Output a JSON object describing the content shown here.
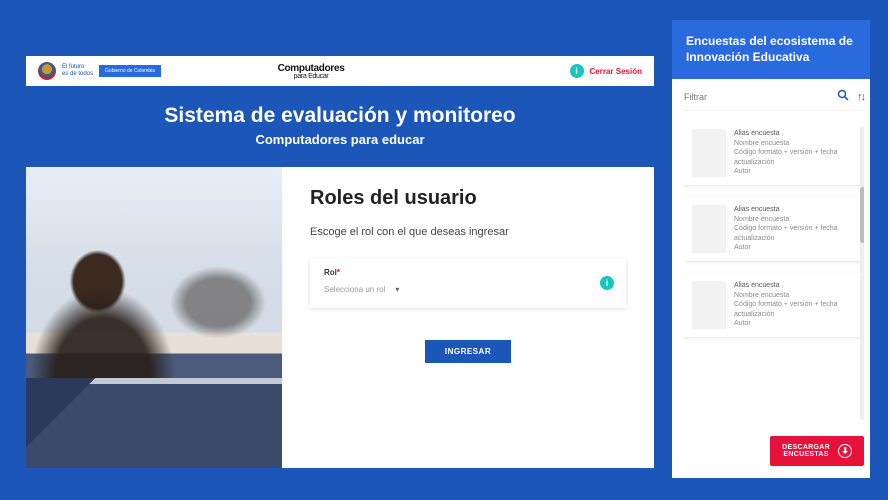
{
  "header": {
    "gov_line1": "El futuro",
    "gov_line2": "es de todos",
    "gov_badge": "Gobierno de Colombia",
    "brand_main": "Computadores",
    "brand_sub": "para Educar",
    "logout_label": "Cerrar Sesión"
  },
  "page": {
    "title": "Sistema de evaluación y monitoreo",
    "subtitle": "Computadores para educar"
  },
  "roles": {
    "heading": "Roles del usuario",
    "instruction": "Escoge el rol con el que deseas ingresar",
    "field_label": "Rol",
    "required_mark": "*",
    "placeholder": "Selecciona un rol",
    "submit_label": "INGRESAR"
  },
  "sidebar": {
    "title": "Encuestas del ecosistema de Innovación Educativa",
    "filter_placeholder": "Filtrar",
    "download_label_line1": "DESCARGAR",
    "download_label_line2": "ENCUESTAS",
    "cards": [
      {
        "alias": "Alias encuesta",
        "name": "Nombre encuesta",
        "meta": "Código formato + versión + fecha actualización",
        "author": "Autor"
      },
      {
        "alias": "Alias encuesta",
        "name": "Nombre encuesta",
        "meta": "Código formato + versión + fecha actualización",
        "author": "Autor"
      },
      {
        "alias": "Alias encuesta",
        "name": "Nombre encuesta",
        "meta": "Código formato + versión + fecha actualización",
        "author": "Autor"
      }
    ]
  }
}
